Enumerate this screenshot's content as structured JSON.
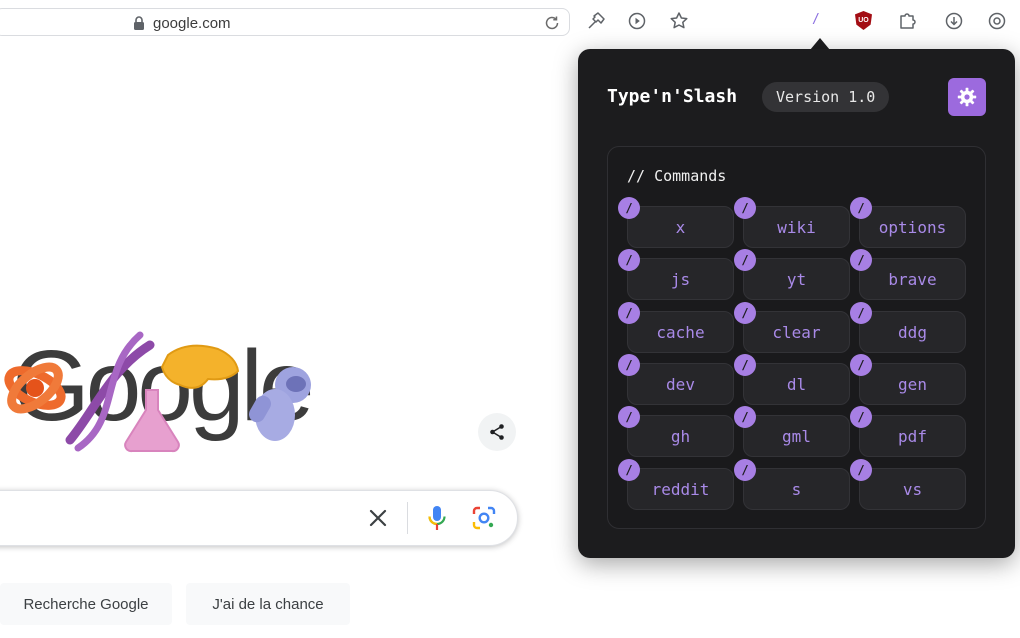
{
  "browser": {
    "url": "google.com",
    "extensions": {
      "slash_label": "/",
      "ublock_label": "UO"
    }
  },
  "google": {
    "buttons": {
      "search": "Recherche Google",
      "lucky": "J'ai de la chance"
    }
  },
  "popup": {
    "title": "Type'n'Slash",
    "version": "Version 1.0",
    "commands_heading": "// Commands",
    "slash_badge": "/",
    "commands": [
      "x",
      "wiki",
      "options",
      "js",
      "yt",
      "brave",
      "cache",
      "clear",
      "ddg",
      "dev",
      "dl",
      "gen",
      "gh",
      "gml",
      "pdf",
      "reddit",
      "s",
      "vs"
    ]
  },
  "colors": {
    "accent": "#9c6ade",
    "command_text": "#a98ae8",
    "popup_bg": "#1c1c1e"
  }
}
